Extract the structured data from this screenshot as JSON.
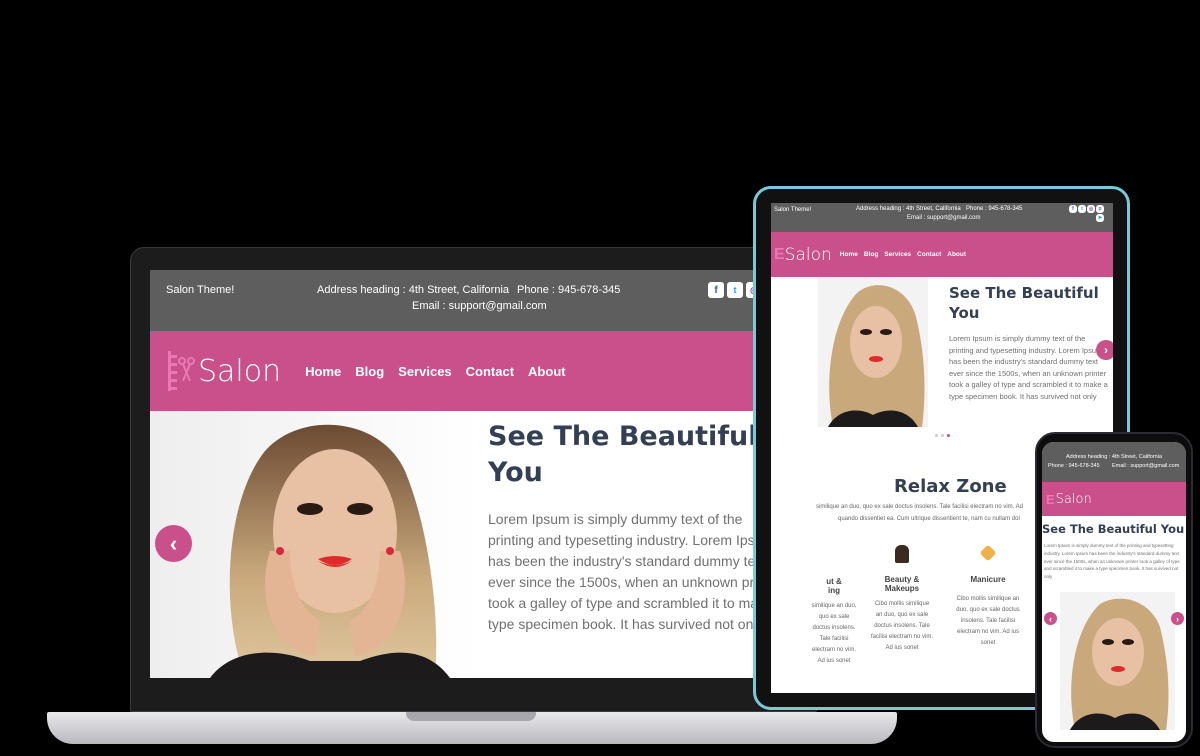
{
  "site": {
    "tagline": "Salon Theme!",
    "address": "Address heading : 4th Street, California",
    "phone": "Phone : 945-678-345",
    "email": "Email : support@gmail.com",
    "logo": "Salon",
    "nav": [
      "Home",
      "Blog",
      "Services",
      "Contact",
      "About"
    ],
    "social": [
      {
        "icon": "facebook-icon",
        "glyph": "f"
      },
      {
        "icon": "twitter-icon",
        "glyph": "t"
      },
      {
        "icon": "instagram-icon",
        "glyph": "◎"
      },
      {
        "icon": "pinterest-icon",
        "glyph": "p"
      },
      {
        "icon": "telegram-icon",
        "glyph": "➤"
      }
    ],
    "colors": {
      "accent": "#c9508a",
      "topbar": "#5e5e5e",
      "title": "#333f52"
    }
  },
  "hero": {
    "title_line1": "See The Beautiful",
    "title_line2": "You",
    "title_full": "See The Beautiful You",
    "body": "Lorem Ipsum is simply dummy text of the printing and typesetting industry. Lorem Ipsum has been the industry's standard dummy text ever since the 1500s, when an unknown printer took a galley of type and scrambled it to make a type specimen book. It has survived not only",
    "prev": "‹",
    "next": "›"
  },
  "tablet": {
    "relax_title": "Relax Zone",
    "relax_text_1": "similique an duo, quo ex sale doctus insolens. Tale facilisi electram no vim. Ad",
    "relax_text_2": "quando dissentiet ea. Cum ultrique dissentient te, nam cu nullam dol",
    "services": [
      {
        "title_1": "ut &",
        "title_2": "ing",
        "text": "similique an duo, quo ex sale doctus insolens. Tale facilisi electram no vim. Ad ius sonet",
        "icon": "hair-icon"
      },
      {
        "title_1": "Beauty &",
        "title_2": "Makeups",
        "text": "Cibo mollis similique an duo, quo ex sale doctus insolens. Tale facilisi electram no vim. Ad ius sonet",
        "icon": "makeup-icon"
      },
      {
        "title_1": "Manicure",
        "title_2": "",
        "text": "Cibo mollis similique an duo, quo ex sale doctus insolens. Tale facilisi electram no vim. Ad ius sonet",
        "icon": "nail-polish-icon"
      }
    ]
  },
  "phone": {
    "body": "Lorem Ipsum is simply dummy text of the printing and typesetting industry. Lorem Ipsum has been the industry's standard dummy text ever since the 1500s, when an unknown printer took a galley of type and scrambled it to make a type specimen book. It has survived not only",
    "phone_email": "Phone : 945-678-345"
  }
}
